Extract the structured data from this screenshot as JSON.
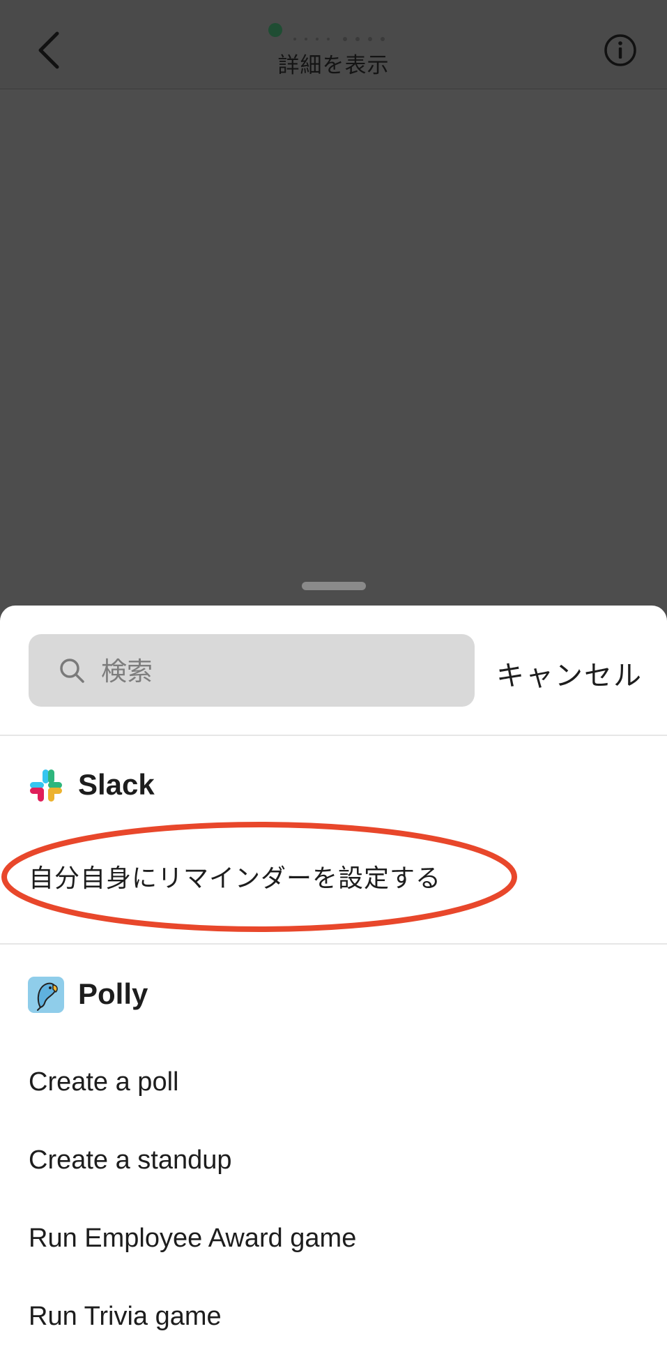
{
  "header": {
    "title": "詳細を表示",
    "back_icon": "chevron-left-icon",
    "info_icon": "info-circle-icon",
    "status_color": "#1f4d33"
  },
  "sheet": {
    "search": {
      "placeholder": "検索",
      "value": ""
    },
    "cancel_label": "キャンセル",
    "apps": [
      {
        "name": "Slack",
        "icon": "slack-logo-icon",
        "actions": [
          "自分自身にリマインダーを設定する"
        ]
      },
      {
        "name": "Polly",
        "icon": "polly-bird-icon",
        "actions": [
          "Create a poll",
          "Create a standup",
          "Run Employee Award game",
          "Run Trivia game"
        ]
      }
    ],
    "highlight_color": "#e8472b"
  }
}
